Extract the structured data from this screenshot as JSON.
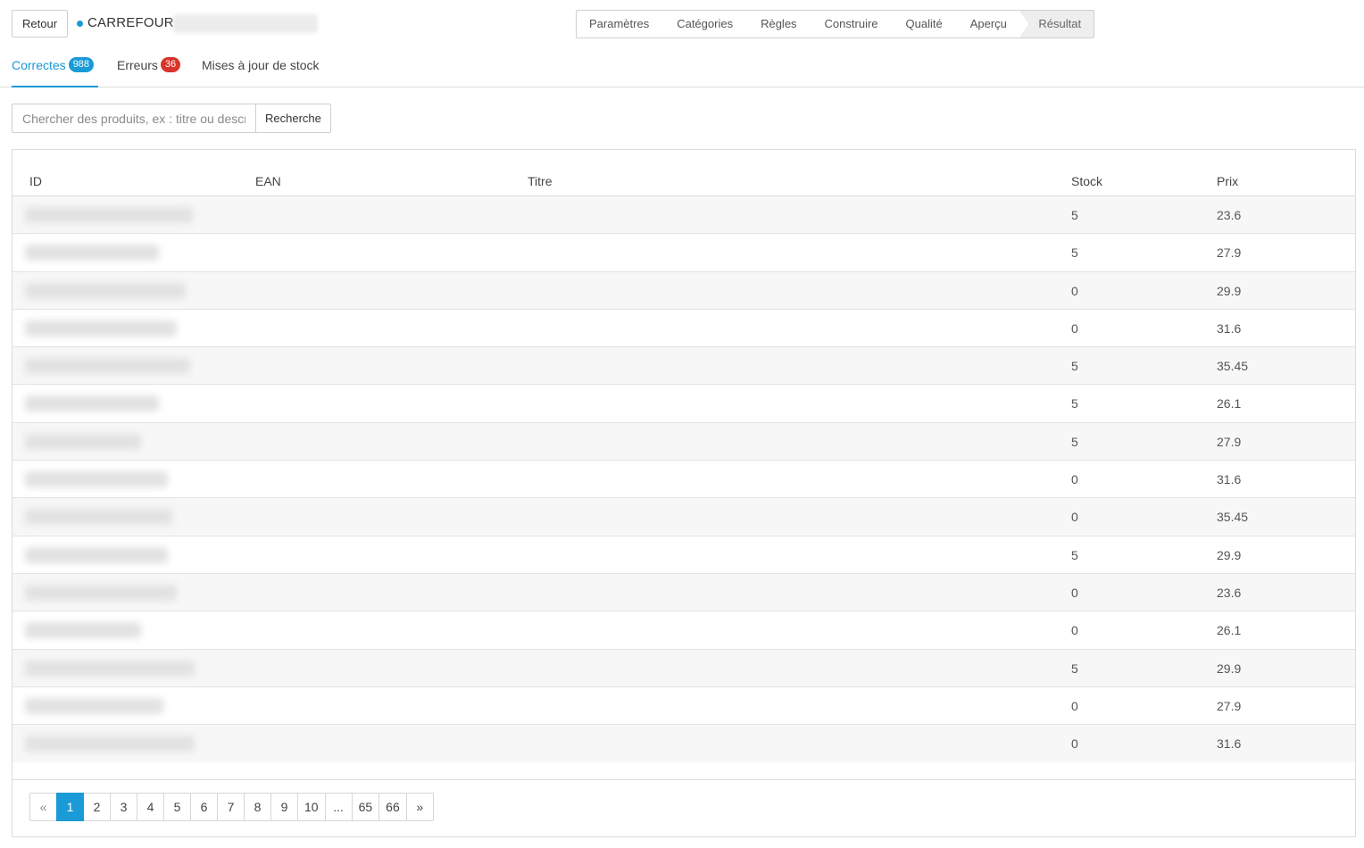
{
  "header": {
    "back_label": "Retour",
    "shop_name": "CARREFOUR",
    "steps": [
      {
        "label": "Paramètres"
      },
      {
        "label": "Catégories"
      },
      {
        "label": "Règles"
      },
      {
        "label": "Construire"
      },
      {
        "label": "Qualité"
      },
      {
        "label": "Aperçu"
      },
      {
        "label": "Résultat"
      }
    ],
    "active_step": "Résultat"
  },
  "tabs": [
    {
      "label": "Correctes",
      "count": "988",
      "active": true
    },
    {
      "label": "Erreurs",
      "count": "36",
      "active": false
    },
    {
      "label": "Mises à jour de stock",
      "count": "",
      "active": false
    }
  ],
  "search": {
    "placeholder": "Chercher des produits, ex : titre ou description",
    "button_label": "Recherche"
  },
  "table": {
    "columns": [
      "ID",
      "EAN",
      "Titre",
      "Stock",
      "Prix"
    ],
    "rows": [
      {
        "stock": "5",
        "price": "23.6"
      },
      {
        "stock": "5",
        "price": "27.9"
      },
      {
        "stock": "0",
        "price": "29.9"
      },
      {
        "stock": "0",
        "price": "31.6"
      },
      {
        "stock": "5",
        "price": "35.45"
      },
      {
        "stock": "5",
        "price": "26.1"
      },
      {
        "stock": "5",
        "price": "27.9"
      },
      {
        "stock": "0",
        "price": "31.6"
      },
      {
        "stock": "0",
        "price": "35.45"
      },
      {
        "stock": "5",
        "price": "29.9"
      },
      {
        "stock": "0",
        "price": "23.6"
      },
      {
        "stock": "0",
        "price": "26.1"
      },
      {
        "stock": "5",
        "price": "29.9"
      },
      {
        "stock": "0",
        "price": "27.9"
      },
      {
        "stock": "0",
        "price": "31.6"
      }
    ]
  },
  "pagination": {
    "prev": "«",
    "pages": [
      "1",
      "2",
      "3",
      "4",
      "5",
      "6",
      "7",
      "8",
      "9",
      "10",
      "...",
      "65",
      "66"
    ],
    "current": "1",
    "next": "»"
  },
  "colors": {
    "accent": "#1a9ad6",
    "error_badge": "#d9342b"
  }
}
